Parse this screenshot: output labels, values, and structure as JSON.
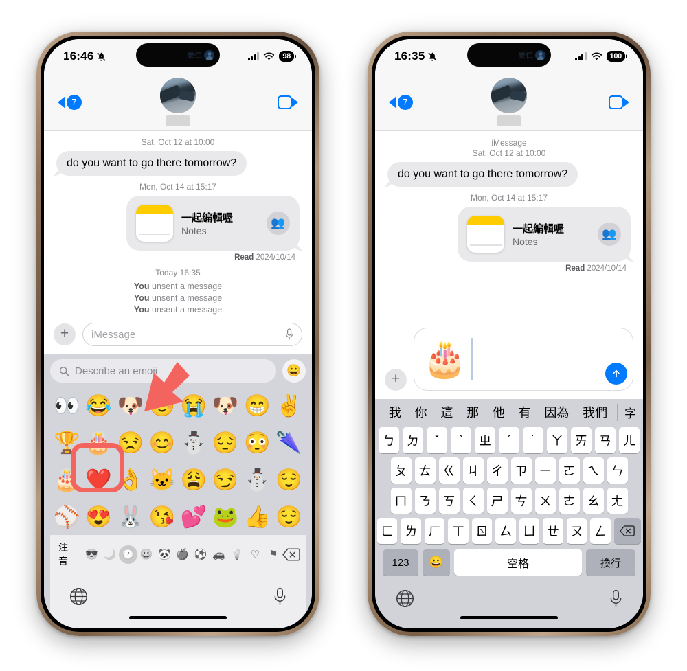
{
  "theme": {
    "accent_blue": "#007aff",
    "bubble_gray": "#e9e9eb",
    "keyboard_gray": "#d1d3d9",
    "annotation_red": "#f4645f",
    "note_yellow": "#ffcc00"
  },
  "phones": [
    {
      "id": "left",
      "status": {
        "time": "16:46",
        "silent_icon": "bell-slash-icon",
        "island_name": "果仁",
        "island_avatar_icon": "person-circle-icon",
        "signal_icon": "cellular-signal-icon",
        "wifi_icon": "wifi-icon",
        "battery": "98"
      },
      "nav": {
        "back_icon": "chevron-left-icon",
        "unread_badge": "7",
        "avatar_icon": "contact-avatar",
        "contact_name_redacted": "",
        "facetime_icon": "video-camera-icon"
      },
      "conversation": {
        "date_divider_top": "Sat, Oct 12 at 10:00",
        "incoming_message": "do you want to go there tomorrow?",
        "date_divider_second": "Mon, Oct 14 at 15:17",
        "note_card": {
          "icon": "notes-app-icon",
          "title": "一起編輯喔",
          "subtitle": "Notes",
          "people_icon": "people-group-icon"
        },
        "read_receipt_prefix": "Read",
        "read_receipt_date": "2024/10/14",
        "today_divider": "Today 16:35",
        "unsent_lines": [
          {
            "who": "You",
            "text": " unsent a message"
          },
          {
            "who": "You",
            "text": " unsent a message"
          },
          {
            "who": "You",
            "text": " unsent a message"
          }
        ]
      },
      "compose": {
        "plus_icon": "plus-icon",
        "placeholder": "iMessage",
        "mic_icon": "microphone-icon"
      },
      "emoji_keyboard": {
        "search_icon": "search-icon",
        "search_placeholder": "Describe an emoji",
        "genmoji_icon": "genmoji-add-icon",
        "rows": [
          [
            "👀",
            "😂",
            "🐶",
            "☺️",
            "😭",
            "🐶",
            "😁",
            "✌️"
          ],
          [
            "🏆",
            "🎂",
            "😒",
            "😊",
            "⛄",
            "😔",
            "😳",
            "🌂"
          ],
          [
            "🎂",
            "❤️",
            "👌",
            "🐱",
            "😩",
            "😏",
            "⛄",
            "😌"
          ],
          [
            "⚾",
            "😍",
            "🐰",
            "😘",
            "💕",
            "🐸",
            "👍",
            "😌"
          ]
        ],
        "category_bar": {
          "zhuyin_label": "注音",
          "icons": [
            "memoji-face-icon",
            "sticker-icon",
            "recents-clock-icon",
            "smileys-icon",
            "animals-nature-icon",
            "food-drink-icon",
            "activity-icon",
            "travel-places-icon",
            "objects-icon",
            "symbols-heart-icon",
            "flags-icon"
          ],
          "active_index": 2,
          "backspace_icon": "backspace-icon"
        },
        "footer": {
          "globe_icon": "globe-icon",
          "mic_icon": "microphone-icon"
        }
      }
    },
    {
      "id": "right",
      "status": {
        "time": "16:35",
        "silent_icon": "bell-slash-icon",
        "island_name": "果仁",
        "island_avatar_icon": "person-circle-icon",
        "signal_icon": "cellular-signal-icon",
        "wifi_icon": "wifi-icon",
        "battery": "100"
      },
      "nav": {
        "back_icon": "chevron-left-icon",
        "unread_badge": "7",
        "avatar_icon": "contact-avatar",
        "contact_name_redacted": "",
        "facetime_icon": "video-camera-icon"
      },
      "conversation": {
        "service_label": "iMessage",
        "date_divider_top": "Sat, Oct 12 at 10:00",
        "incoming_message": "do you want to go there tomorrow?",
        "date_divider_second": "Mon, Oct 14 at 15:17",
        "note_card": {
          "icon": "notes-app-icon",
          "title": "一起編輯喔",
          "subtitle": "Notes",
          "people_icon": "people-group-icon"
        },
        "read_receipt_prefix": "Read",
        "read_receipt_date": "2024/10/14"
      },
      "compose": {
        "plus_icon": "plus-icon",
        "typed_emoji": "🎂",
        "send_icon": "send-arrow-up-icon"
      },
      "zhuyin_keyboard": {
        "suggestions": [
          "我",
          "你",
          "這",
          "那",
          "他",
          "有",
          "因為",
          "我們"
        ],
        "more_label": "字",
        "rows": [
          [
            "ㄅ",
            "ㄉ",
            "ˇ",
            "ˋ",
            "ㄓ",
            "ˊ",
            "˙",
            "ㄚ",
            "ㄞ",
            "ㄢ",
            "ㄦ"
          ],
          [
            "ㄆ",
            "ㄊ",
            "ㄍ",
            "ㄐ",
            "ㄔ",
            "ㄗ",
            "ㄧ",
            "ㄛ",
            "ㄟ",
            "ㄣ"
          ],
          [
            "ㄇ",
            "ㄋ",
            "ㄎ",
            "ㄑ",
            "ㄕ",
            "ㄘ",
            "ㄨ",
            "ㄜ",
            "ㄠ",
            "ㄤ"
          ],
          [
            "ㄈ",
            "ㄌ",
            "ㄏ",
            "ㄒ",
            "ㄖ",
            "ㄙ",
            "ㄩ",
            "ㄝ",
            "ㄡ",
            "ㄥ"
          ]
        ],
        "backspace_icon": "backspace-icon",
        "bottom": {
          "numeric_label": "123",
          "emoji_icon": "emoji-smiley-icon",
          "space_label": "空格",
          "return_label": "換行"
        },
        "footer": {
          "globe_icon": "globe-icon",
          "mic_icon": "microphone-icon"
        }
      }
    }
  ],
  "annotations": {
    "arrow": {
      "name": "red-pointer-arrow",
      "color": "#f4645f"
    },
    "highlight_box": {
      "name": "red-highlight-box",
      "color": "#f4645f",
      "targets_emoji": "🎂"
    }
  }
}
